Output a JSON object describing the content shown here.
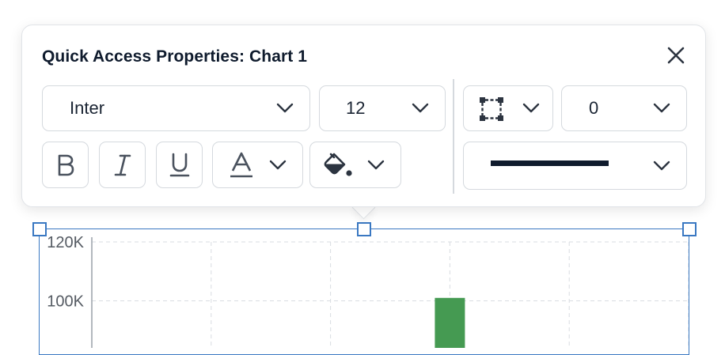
{
  "popup": {
    "title": "Quick Access Properties: Chart 1",
    "font_family_value": "Inter",
    "font_size_value": "12",
    "border_width_value": "0",
    "line_color": "#0f1b2d",
    "icons": {
      "close": "close-icon",
      "bold": "bold-icon",
      "italic": "italic-icon",
      "underline": "underline-icon",
      "text_color": "text-color-icon",
      "fill": "paint-bucket-icon",
      "border": "border-box-icon",
      "chevron": "chevron-down-icon"
    }
  },
  "chart_data": {
    "type": "bar",
    "y_tick_labels": [
      "120K",
      "100K"
    ],
    "bar_color": "#459a52",
    "values": [
      {
        "x_index": 3,
        "value": 101000
      }
    ],
    "grid": true,
    "ylim_visible": [
      100000,
      120000
    ]
  }
}
